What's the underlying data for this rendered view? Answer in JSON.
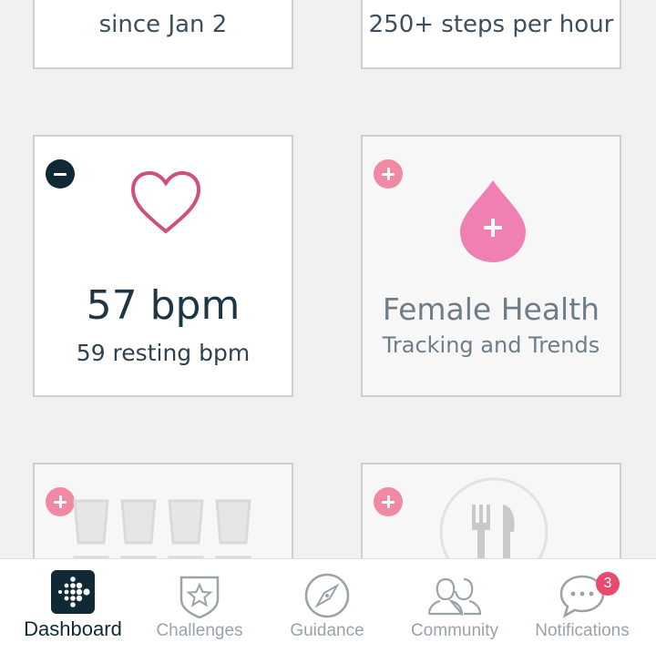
{
  "tiles": {
    "streak": {
      "text": "since Jan 2"
    },
    "hourly": {
      "text": "250+ steps per hour"
    },
    "heart_rate": {
      "value": "57 bpm",
      "resting": "59 resting bpm",
      "icon": "heart-icon",
      "color": "#cf4f7f"
    },
    "female_health": {
      "title": "Female Health",
      "subtitle": "Tracking and Trends",
      "icon": "droplet-plus-icon",
      "color": "#f07fb4"
    },
    "water": {
      "icon": "water-glasses-icon"
    },
    "food": {
      "icon": "fork-knife-icon"
    }
  },
  "tabbar": {
    "tabs": [
      {
        "label": "Dashboard",
        "icon": "fitbit-logo-icon",
        "active": true
      },
      {
        "label": "Challenges",
        "icon": "star-badge-icon"
      },
      {
        "label": "Guidance",
        "icon": "compass-icon"
      },
      {
        "label": "Community",
        "icon": "people-icon"
      },
      {
        "label": "Notifications",
        "icon": "chat-bubble-icon",
        "badge": "3"
      }
    ]
  },
  "colors": {
    "navy": "#0f2a36",
    "pink": "#f08aa4",
    "badge": "#e8496f"
  }
}
